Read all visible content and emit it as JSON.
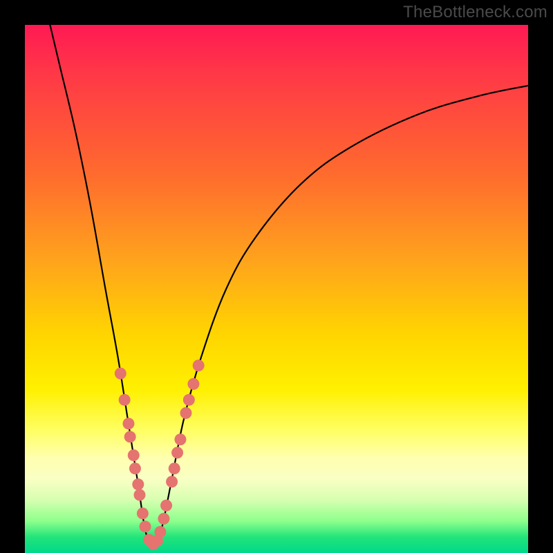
{
  "watermark": "TheBottleneck.com",
  "colors": {
    "frame": "#000000",
    "curve": "#000000",
    "dot": "#e5736f",
    "gradient_stops": [
      {
        "pct": 0,
        "color": "#ff1a53"
      },
      {
        "pct": 10,
        "color": "#ff3a46"
      },
      {
        "pct": 28,
        "color": "#ff6a2e"
      },
      {
        "pct": 44,
        "color": "#ffa11d"
      },
      {
        "pct": 59,
        "color": "#ffd600"
      },
      {
        "pct": 69,
        "color": "#fff000"
      },
      {
        "pct": 77,
        "color": "#ffff66"
      },
      {
        "pct": 82,
        "color": "#ffffb0"
      },
      {
        "pct": 86,
        "color": "#f9ffc4"
      },
      {
        "pct": 90,
        "color": "#d6ffb0"
      },
      {
        "pct": 94,
        "color": "#8cff8c"
      },
      {
        "pct": 97,
        "color": "#22e47a"
      },
      {
        "pct": 100,
        "color": "#00d88a"
      }
    ]
  },
  "chart_data": {
    "type": "line",
    "title": "",
    "xlabel": "",
    "ylabel": "",
    "xlim": [
      0,
      100
    ],
    "ylim": [
      0,
      100
    ],
    "note": "V-shaped bottleneck curve with minimum near x≈25. Values below are (x, y) in percent of plot width/height, y measured from bottom (0) to top (100).",
    "series": [
      {
        "name": "bottleneck-curve",
        "data": [
          {
            "x": 5.0,
            "y": 100.0
          },
          {
            "x": 7.0,
            "y": 92.0
          },
          {
            "x": 10.0,
            "y": 80.0
          },
          {
            "x": 13.0,
            "y": 66.0
          },
          {
            "x": 16.0,
            "y": 50.0
          },
          {
            "x": 18.5,
            "y": 37.0
          },
          {
            "x": 20.5,
            "y": 25.0
          },
          {
            "x": 22.5,
            "y": 13.0
          },
          {
            "x": 24.0,
            "y": 4.0
          },
          {
            "x": 25.5,
            "y": 1.5
          },
          {
            "x": 27.0,
            "y": 4.0
          },
          {
            "x": 29.0,
            "y": 13.0
          },
          {
            "x": 31.5,
            "y": 25.0
          },
          {
            "x": 35.0,
            "y": 37.0
          },
          {
            "x": 40.0,
            "y": 50.0
          },
          {
            "x": 46.0,
            "y": 60.0
          },
          {
            "x": 55.0,
            "y": 70.0
          },
          {
            "x": 65.0,
            "y": 77.0
          },
          {
            "x": 78.0,
            "y": 83.0
          },
          {
            "x": 90.0,
            "y": 86.5
          },
          {
            "x": 100.0,
            "y": 88.5
          }
        ]
      }
    ],
    "scatter_points": {
      "name": "sampled-dots",
      "note": "Pink/salmon dots lying on the curve, clustered near the trough.",
      "data": [
        {
          "x": 19.0,
          "y": 34.0
        },
        {
          "x": 19.8,
          "y": 29.0
        },
        {
          "x": 20.6,
          "y": 24.5
        },
        {
          "x": 20.9,
          "y": 22.0
        },
        {
          "x": 21.6,
          "y": 18.5
        },
        {
          "x": 21.9,
          "y": 16.0
        },
        {
          "x": 22.5,
          "y": 13.0
        },
        {
          "x": 22.8,
          "y": 11.0
        },
        {
          "x": 23.4,
          "y": 7.5
        },
        {
          "x": 23.9,
          "y": 5.0
        },
        {
          "x": 24.7,
          "y": 2.5
        },
        {
          "x": 25.5,
          "y": 1.7
        },
        {
          "x": 26.3,
          "y": 2.3
        },
        {
          "x": 26.9,
          "y": 4.0
        },
        {
          "x": 27.6,
          "y": 6.5
        },
        {
          "x": 28.1,
          "y": 9.0
        },
        {
          "x": 29.2,
          "y": 13.5
        },
        {
          "x": 29.7,
          "y": 16.0
        },
        {
          "x": 30.3,
          "y": 19.0
        },
        {
          "x": 30.9,
          "y": 21.5
        },
        {
          "x": 32.0,
          "y": 26.5
        },
        {
          "x": 32.6,
          "y": 29.0
        },
        {
          "x": 33.5,
          "y": 32.0
        },
        {
          "x": 34.5,
          "y": 35.5
        }
      ]
    }
  }
}
